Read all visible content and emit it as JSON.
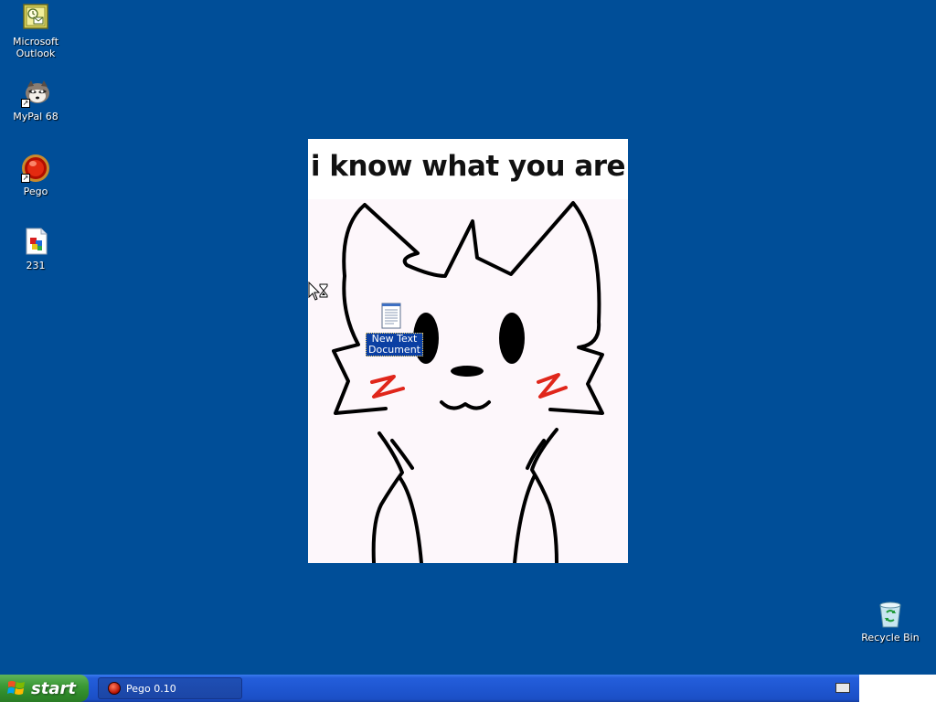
{
  "desktop": {
    "background_color": "#004e98",
    "icons": [
      {
        "label_line1": "Microsoft",
        "label_line2": "Outlook",
        "icon": "outlook-icon"
      },
      {
        "label_line1": "MyPal 68",
        "label_line2": "",
        "icon": "mypal-raccoon-icon"
      },
      {
        "label_line1": "Pego",
        "label_line2": "",
        "icon": "pego-red-orb-icon"
      },
      {
        "label_line1": "231",
        "label_line2": "",
        "icon": "image-file-icon"
      }
    ],
    "recycle_bin": {
      "label": "Recycle Bin",
      "icon": "recycle-bin-icon"
    }
  },
  "picture": {
    "caption": "i know what you are"
  },
  "text_document": {
    "label_line1": "New Text",
    "label_line2": "Document",
    "icon": "notepad-document-icon"
  },
  "taskbar": {
    "start_label": "start",
    "tasks": [
      {
        "label": "Pego 0.10",
        "icon": "pego-red-orb-icon"
      }
    ],
    "tray_icon": "keyboard-icon"
  }
}
